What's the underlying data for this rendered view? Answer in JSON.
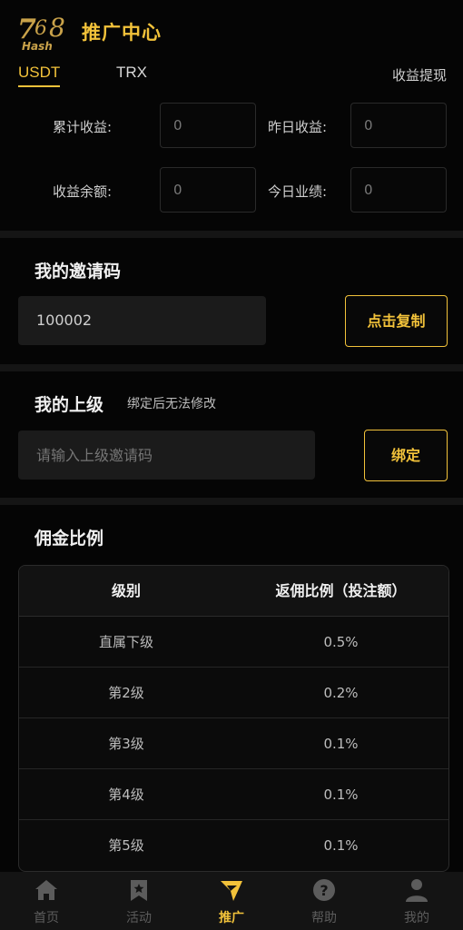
{
  "header": {
    "logo_text": "768 Hash",
    "title": "推广中心"
  },
  "tabs": [
    {
      "label": "USDT",
      "active": true
    },
    {
      "label": "TRX",
      "active": false
    }
  ],
  "withdraw_label": "收益提现",
  "stats": {
    "total_label": "累计收益:",
    "total_value": "0",
    "yesterday_label": "昨日收益:",
    "yesterday_value": "0",
    "balance_label": "收益余额:",
    "balance_value": "0",
    "today_label": "今日业绩:",
    "today_value": "0"
  },
  "invite": {
    "title": "我的邀请码",
    "code": "100002",
    "copy_label": "点击复制"
  },
  "superior": {
    "title": "我的上级",
    "subtitle": "绑定后无法修改",
    "placeholder": "请输入上级邀请码",
    "bind_label": "绑定"
  },
  "commission": {
    "title": "佣金比例",
    "headers": [
      "级别",
      "返佣比例（投注额）"
    ],
    "rows": [
      [
        "直属下级",
        "0.5%"
      ],
      [
        "第2级",
        "0.2%"
      ],
      [
        "第3级",
        "0.1%"
      ],
      [
        "第4级",
        "0.1%"
      ],
      [
        "第5级",
        "0.1%"
      ]
    ]
  },
  "nav": [
    {
      "label": "首页",
      "icon": "home-icon",
      "active": false
    },
    {
      "label": "活动",
      "icon": "bookmark-icon",
      "active": false
    },
    {
      "label": "推广",
      "icon": "paper-plane-icon",
      "active": true
    },
    {
      "label": "帮助",
      "icon": "help-icon",
      "active": false
    },
    {
      "label": "我的",
      "icon": "user-icon",
      "active": false
    }
  ],
  "colors": {
    "accent": "#f2c23a",
    "background": "#050505",
    "panel": "#1b1b1b",
    "nav_inactive": "#5c5c5c"
  }
}
